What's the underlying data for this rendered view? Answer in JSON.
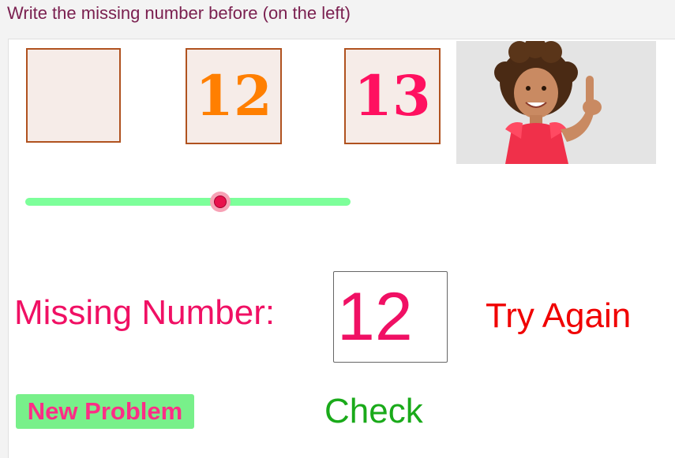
{
  "instruction": "Write the missing number before (on the left)",
  "boxes": {
    "left": "",
    "middle": "12",
    "right": "13"
  },
  "photo_icon": "child-pointing-up-photo",
  "slider": {
    "value_fraction": 0.6
  },
  "answer": {
    "label": "Missing Number:",
    "value": "12"
  },
  "feedback": "Try Again",
  "buttons": {
    "new_problem": "New Problem",
    "check": "Check"
  },
  "colors": {
    "box_fill": "#f6ece8",
    "box_border": "#b0521f",
    "middle_number": "#ff7f00",
    "right_number": "#ff1060",
    "label_pink": "#f01064",
    "feedback_red": "#f00000",
    "check_green": "#1aaa1a",
    "slider_track": "#7dff9a",
    "slider_thumb": "#e8114c"
  }
}
